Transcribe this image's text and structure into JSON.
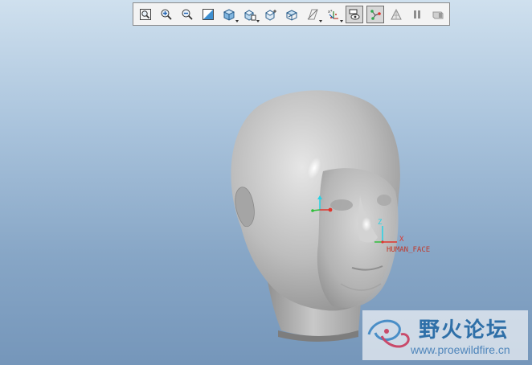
{
  "toolbar": {
    "buttons": [
      {
        "icon": "refit-icon",
        "dropdown": false,
        "active": false
      },
      {
        "icon": "zoom-in-icon",
        "dropdown": false,
        "active": false
      },
      {
        "icon": "zoom-out-icon",
        "dropdown": false,
        "active": false
      },
      {
        "icon": "repaint-icon",
        "dropdown": false,
        "active": false
      },
      {
        "icon": "display-style-icon",
        "dropdown": true,
        "active": false
      },
      {
        "icon": "saved-orientations-icon",
        "dropdown": true,
        "active": false
      },
      {
        "icon": "view-manager-icon",
        "dropdown": false,
        "active": false
      },
      {
        "icon": "reorient-icon",
        "dropdown": false,
        "active": false
      },
      {
        "icon": "datum-planes-icon",
        "dropdown": true,
        "active": false
      },
      {
        "icon": "datum-display-icon",
        "dropdown": true,
        "active": false
      },
      {
        "icon": "annotation-display-icon",
        "dropdown": false,
        "active": true
      },
      {
        "icon": "spin-center-icon",
        "dropdown": false,
        "active": true
      },
      {
        "icon": "perspective-icon",
        "dropdown": false,
        "active": false
      },
      {
        "icon": "pause-icon",
        "dropdown": false,
        "active": false
      },
      {
        "icon": "render-icon",
        "dropdown": false,
        "active": false
      }
    ]
  },
  "model": {
    "csys_name": "HUMAN_FACE",
    "axis_x": "X",
    "axis_z": "Z",
    "colors": {
      "x_axis": "#e0342c",
      "y_axis": "#2fbf3a",
      "z_axis": "#25d3e6",
      "label": "#c0392b"
    }
  },
  "watermark": {
    "title": "野火论坛",
    "url": "www.proewildfire.cn"
  }
}
